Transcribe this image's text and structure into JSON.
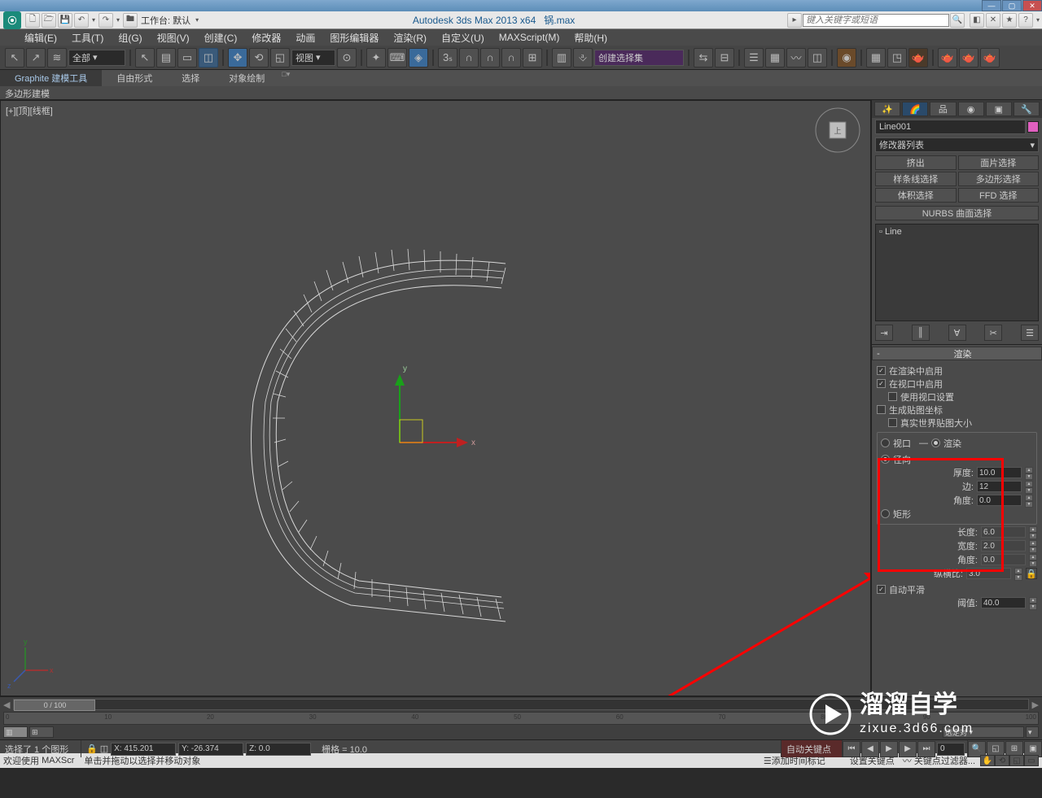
{
  "title": {
    "app": "Autodesk 3ds Max  2013 x64",
    "file": "锅.max",
    "workspace_label": "工作台: 默认",
    "search_placeholder": "键入关键字或短语"
  },
  "menus": [
    "编辑(E)",
    "工具(T)",
    "组(G)",
    "视图(V)",
    "创建(C)",
    "修改器",
    "动画",
    "图形编辑器",
    "渲染(R)",
    "自定义(U)",
    "MAXScript(M)",
    "帮助(H)"
  ],
  "toolbar": {
    "filter_all": "全部",
    "viewlabel": "视图",
    "createset": "创建选择集"
  },
  "ribbon": {
    "tabs": [
      "Graphite 建模工具",
      "自由形式",
      "选择",
      "对象绘制"
    ],
    "subline": "多边形建模"
  },
  "viewport": {
    "label": "[+][顶][线框]"
  },
  "panel": {
    "objname": "Line001",
    "modlist": "修改器列表",
    "modbuttons": [
      "挤出",
      "面片选择",
      "样条线选择",
      "多边形选择",
      "体积选择",
      "FFD 选择"
    ],
    "nurbs": "NURBS 曲面选择",
    "stackitem": "Line",
    "rollup": {
      "title": "渲染",
      "enable_render": "在渲染中启用",
      "enable_vp": "在视口中启用",
      "use_vp_settings": "使用视口设置",
      "gen_uv": "生成贴图坐标",
      "real_world": "真实世界贴图大小",
      "viewport": "视口",
      "render": "渲染",
      "radial": "径向",
      "thickness_label": "厚度:",
      "thickness": "10.0",
      "sides_label": "边:",
      "sides": "12",
      "angle_label": "角度:",
      "angle": "0.0",
      "rect": "矩形",
      "length_label": "长度:",
      "length": "6.0",
      "width_label": "宽度:",
      "width": "2.0",
      "angle2_label": "角度:",
      "angle2": "0.0",
      "aspect_label": "纵横比:",
      "aspect": "3.0",
      "autosmooth": "自动平滑",
      "threshold_label": "阈值:",
      "threshold": "40.0"
    }
  },
  "timeline": {
    "frame": "0 / 100"
  },
  "status": {
    "selected": "选择了 1 个图形",
    "hint": "单击并拖动以选择并移动对象",
    "x": "X: 415.201",
    "y": "Y: -26.374",
    "z": "Z: 0.0",
    "grid": "栅格 = 10.0",
    "addtime": "添加时间标记",
    "autokey": "自动关键点",
    "setkey": "设置关键点",
    "selkey": "选定对",
    "keyfilter": "关键点过滤器..."
  },
  "bottom": {
    "welcome": "欢迎使用",
    "maxscr": "MAXScr"
  },
  "watermark": {
    "line1": "溜溜自学",
    "line2": "zixue.3d66.com"
  }
}
